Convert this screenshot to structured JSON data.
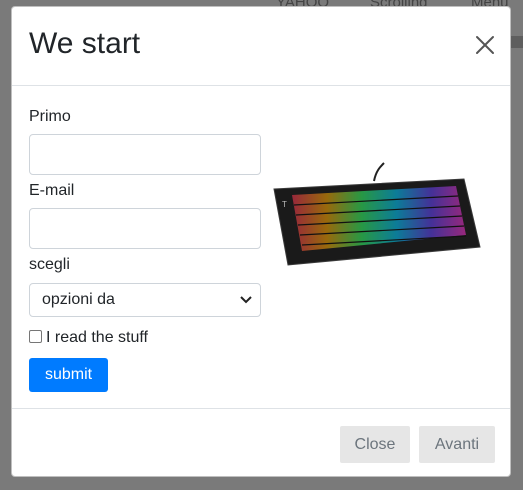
{
  "background_nav": [
    "YAHOO",
    "Scrolling",
    "Menu"
  ],
  "modal": {
    "title": "We start",
    "close_icon": "close-icon",
    "form": {
      "first_label": "Primo",
      "first_value": "",
      "email_label": "E-mail",
      "email_value": "",
      "select_label": "scegli",
      "select_value": "opzioni da",
      "checkbox_label": "I read the stuff",
      "checkbox_checked": false,
      "submit_label": "submit"
    },
    "image": "rgb-keyboard",
    "footer": {
      "close_label": "Close",
      "next_label": "Avanti"
    }
  },
  "colors": {
    "primary": "#007bff",
    "overlay": "#7a7a7a",
    "secondary_button": "#e6e6e6"
  }
}
